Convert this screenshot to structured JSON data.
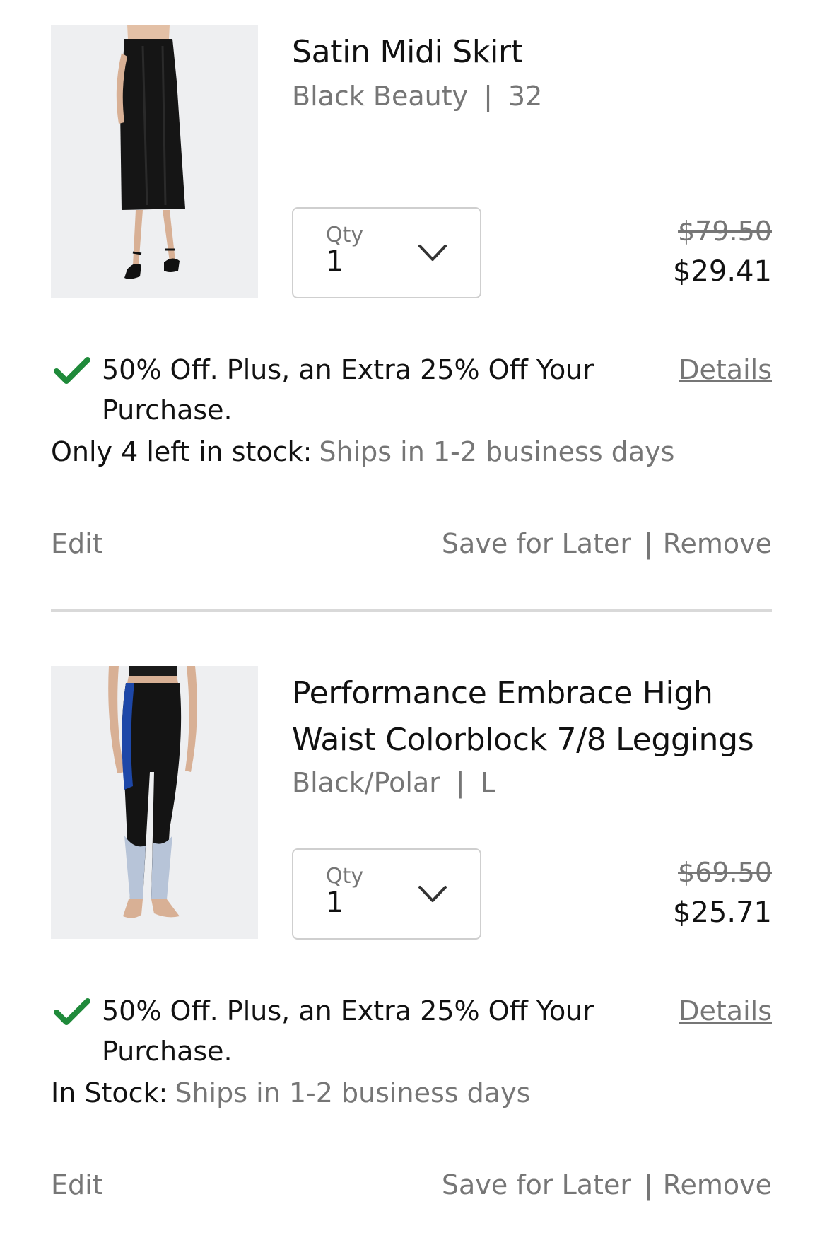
{
  "items": [
    {
      "title": "Satin Midi Skirt",
      "color": "Black Beauty",
      "size": "32",
      "variant_separator": "|",
      "qty_label": "Qty",
      "qty_value": "1",
      "price_original": "$79.50",
      "price_sale": "$29.41",
      "promo": "50% Off. Plus, an Extra 25% Off Your Purchase.",
      "details": "Details",
      "stock_status": "Only 4 left in stock:",
      "shipping": "Ships in 1-2 business days",
      "edit": "Edit",
      "save_for_later": "Save for Later",
      "action_separator": "|",
      "remove": "Remove"
    },
    {
      "title": "Performance Embrace High Waist Colorblock 7/8 Leggings",
      "color": "Black/Polar",
      "size": "L",
      "variant_separator": "|",
      "qty_label": "Qty",
      "qty_value": "1",
      "price_original": "$69.50",
      "price_sale": "$25.71",
      "promo": "50% Off. Plus, an Extra 25% Off Your Purchase.",
      "details": "Details",
      "stock_status": "In Stock:",
      "shipping": "Ships in 1-2 business days",
      "edit": "Edit",
      "save_for_later": "Save for Later",
      "action_separator": "|",
      "remove": "Remove"
    }
  ],
  "colors": {
    "check_green": "#1f8a3a",
    "muted_text": "#767676",
    "divider": "#d9d9d9"
  },
  "icons": [
    "chevron-down-icon",
    "checkmark-icon"
  ]
}
